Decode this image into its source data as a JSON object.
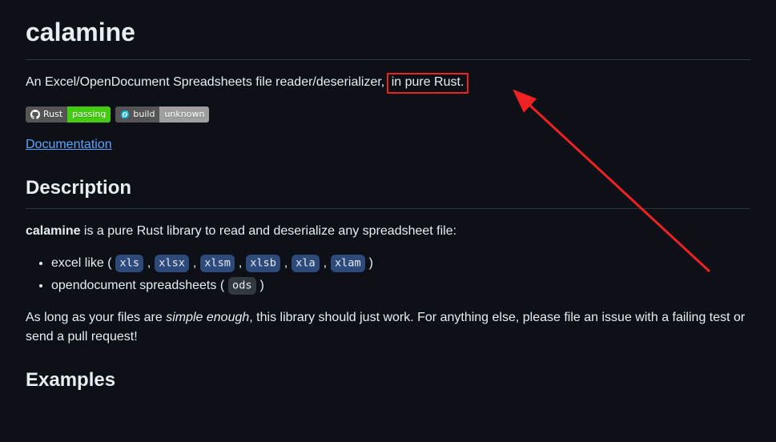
{
  "title": "calamine",
  "summary_before": "An Excel/OpenDocument Spreadsheets file reader/deserializer, ",
  "summary_highlight": "in pure Rust.",
  "badges": [
    {
      "left": "Rust",
      "right": "passing",
      "right_class": "pass",
      "icon": "github"
    },
    {
      "left": "build",
      "right": "unknown",
      "right_class": "unknown",
      "icon": "appveyor"
    }
  ],
  "doc_link": "Documentation",
  "section_description": "Description",
  "desc_line": {
    "strong": "calamine",
    "rest": " is a pure Rust library to read and deserialize any spreadsheet file:"
  },
  "formats": {
    "excel_prefix": "excel like ( ",
    "excel": [
      "xls",
      "xlsx",
      "xlsm",
      "xlsb",
      "xla",
      "xlam"
    ],
    "excel_suffix": " )",
    "od_prefix": "opendocument spreadsheets ( ",
    "od": "ods",
    "od_suffix": " )"
  },
  "note_before": "As long as your files are ",
  "note_em": "simple enough",
  "note_after": ", this library should just work. For anything else, please file an issue with a failing test or send a pull request!",
  "section_examples": "Examples"
}
